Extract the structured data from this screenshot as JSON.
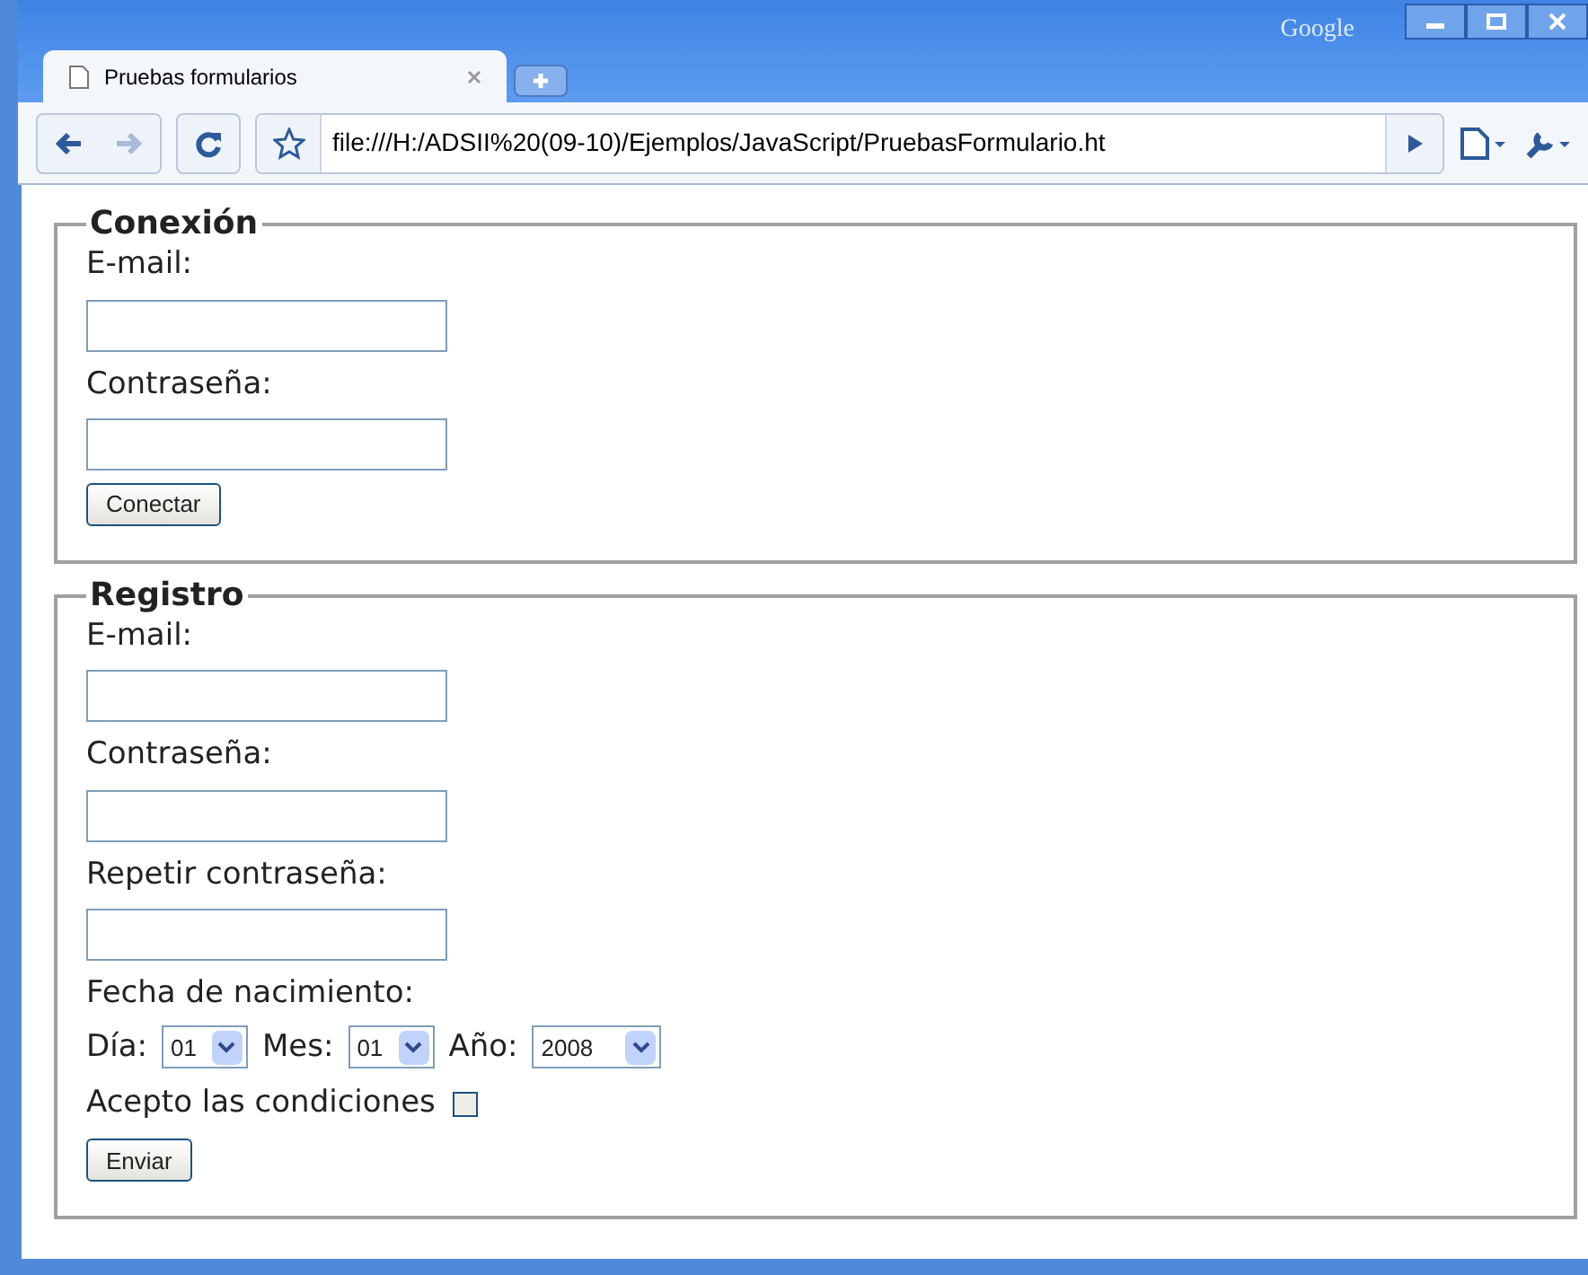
{
  "window": {
    "brand": "Google"
  },
  "tabs": [
    {
      "title": "Pruebas formularios",
      "selected": true
    }
  ],
  "address_bar": {
    "url": "file:///H:/ADSII%20(09-10)/Ejemplos/JavaScript/PruebasFormulario.ht"
  },
  "sections": [
    {
      "legend": "Conexión",
      "fields": [
        {
          "kind": "text",
          "label": "E-mail:"
        },
        {
          "kind": "text",
          "label": "Contraseña:"
        }
      ],
      "button": "Conectar"
    },
    {
      "legend": "Registro",
      "fields": [
        {
          "kind": "text",
          "label": "E-mail:"
        },
        {
          "kind": "text",
          "label": "Contraseña:"
        },
        {
          "kind": "text",
          "label": "Repetir contraseña:"
        },
        {
          "kind": "date",
          "label": "Fecha de nacimiento:",
          "parts": [
            {
              "label": "Día:",
              "value": "01"
            },
            {
              "label": "Mes:",
              "value": "01"
            },
            {
              "label": "Año:",
              "value": "2008"
            }
          ]
        },
        {
          "kind": "checkbox",
          "label": "Acepto las condiciones",
          "checked": false
        }
      ],
      "button": "Enviar"
    }
  ]
}
